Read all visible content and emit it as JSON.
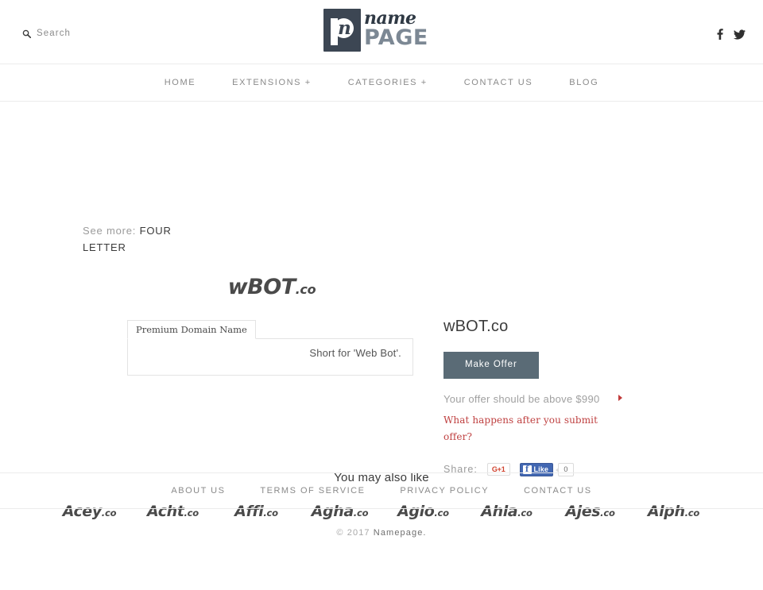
{
  "header": {
    "search_label": "Search",
    "search_icon": "search-icon",
    "logo": {
      "mark_glyph": "n",
      "script_text": "name",
      "bold_text": "PAGE"
    },
    "social": [
      {
        "name": "facebook-icon",
        "label": "f"
      },
      {
        "name": "twitter-icon",
        "label": "t"
      }
    ]
  },
  "nav": {
    "items": [
      {
        "label": "HOME"
      },
      {
        "label": "EXTENSIONS +"
      },
      {
        "label": "CATEGORIES +"
      },
      {
        "label": "CONTACT US"
      },
      {
        "label": "BLOG"
      }
    ]
  },
  "see_more": {
    "label": "See more:",
    "link": "FOUR LETTER"
  },
  "domain_logo": {
    "name": "wBOT",
    "tld": ".co"
  },
  "tabs": {
    "active_tab": "Premium Domain Name",
    "panel_text": "Short for 'Web Bot'."
  },
  "detail": {
    "title": "wBOT.co",
    "make_offer_label": "Make Offer",
    "offer_note": "Your offer should be above $990",
    "offer_question": "What happens after you submit offer?",
    "share_label": "Share:",
    "gplus_label": "G+1",
    "fb_like_label": "Like",
    "fb_count": "0",
    "accent_color": "#bf4040",
    "button_color": "#5a6b76"
  },
  "related": {
    "title": "You may also like",
    "items": [
      {
        "name": "Acey",
        "tld": ".co"
      },
      {
        "name": "Acht",
        "tld": ".co"
      },
      {
        "name": "Affi",
        "tld": ".co"
      },
      {
        "name": "Agha",
        "tld": ".co"
      },
      {
        "name": "Agio",
        "tld": ".co"
      },
      {
        "name": "Ahla",
        "tld": ".co"
      },
      {
        "name": "Ajes",
        "tld": ".co"
      },
      {
        "name": "Alph",
        "tld": ".co"
      }
    ]
  },
  "footer": {
    "links": [
      {
        "label": "ABOUT US"
      },
      {
        "label": "TERMS OF SERVICE"
      },
      {
        "label": "PRIVACY POLICY"
      },
      {
        "label": "CONTACT US"
      }
    ],
    "copyright_prefix": "© 2017 ",
    "copyright_brand": "Namepage."
  }
}
